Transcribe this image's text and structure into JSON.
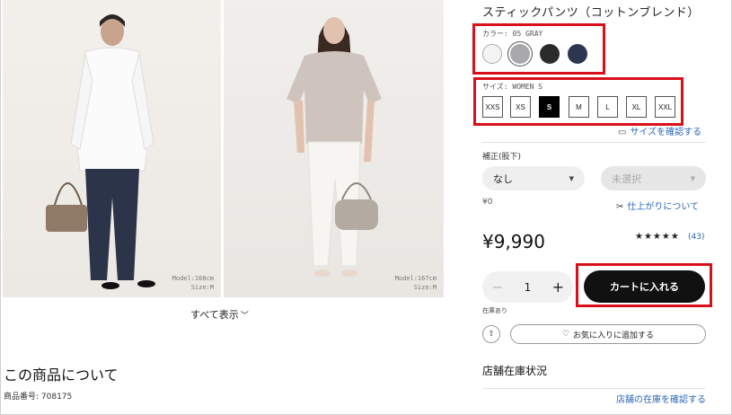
{
  "product": {
    "title": "スティックパンツ（コットンブレンド）",
    "photos": [
      {
        "model_info_1": "Model:168cm",
        "model_info_2": "Size:M"
      },
      {
        "model_info_1": "Model:167cm",
        "model_info_2": "Size:M"
      }
    ],
    "show_all": "すべて表示",
    "about_title": "この商品について",
    "product_number": "商品番号: 708175"
  },
  "color": {
    "label": "カラー: 05 GRAY",
    "swatches": [
      {
        "name": "white",
        "hex": "#f4f4f4"
      },
      {
        "name": "gray",
        "hex": "#a9a9ad",
        "selected": true
      },
      {
        "name": "black",
        "hex": "#2b2b2b"
      },
      {
        "name": "navy",
        "hex": "#2c3650"
      }
    ]
  },
  "size": {
    "label": "サイズ: WOMEN S",
    "options": [
      "XXS",
      "XS",
      "S",
      "M",
      "L",
      "XL",
      "XXL"
    ],
    "selected": "S",
    "check_link": "サイズを確認する"
  },
  "alteration": {
    "label": "補正(股下)",
    "dropdown1": "なし",
    "dropdown2": "未選択",
    "price": "¥0",
    "finish_link": "仕上がりについて"
  },
  "price": "¥9,990",
  "rating": {
    "stars": "★★★★★",
    "count": "(43)"
  },
  "quantity": {
    "value": "1",
    "minus": "−",
    "plus": "+"
  },
  "cart_button": "カートに入れる",
  "stock_text": "在庫あり",
  "favorite_button": "お気に入りに追加する",
  "store": {
    "title": "店舗在庫状況",
    "link": "店舗の在庫を確認する"
  },
  "colors": {
    "highlight": "#d9101b",
    "link": "#2a67b8"
  }
}
